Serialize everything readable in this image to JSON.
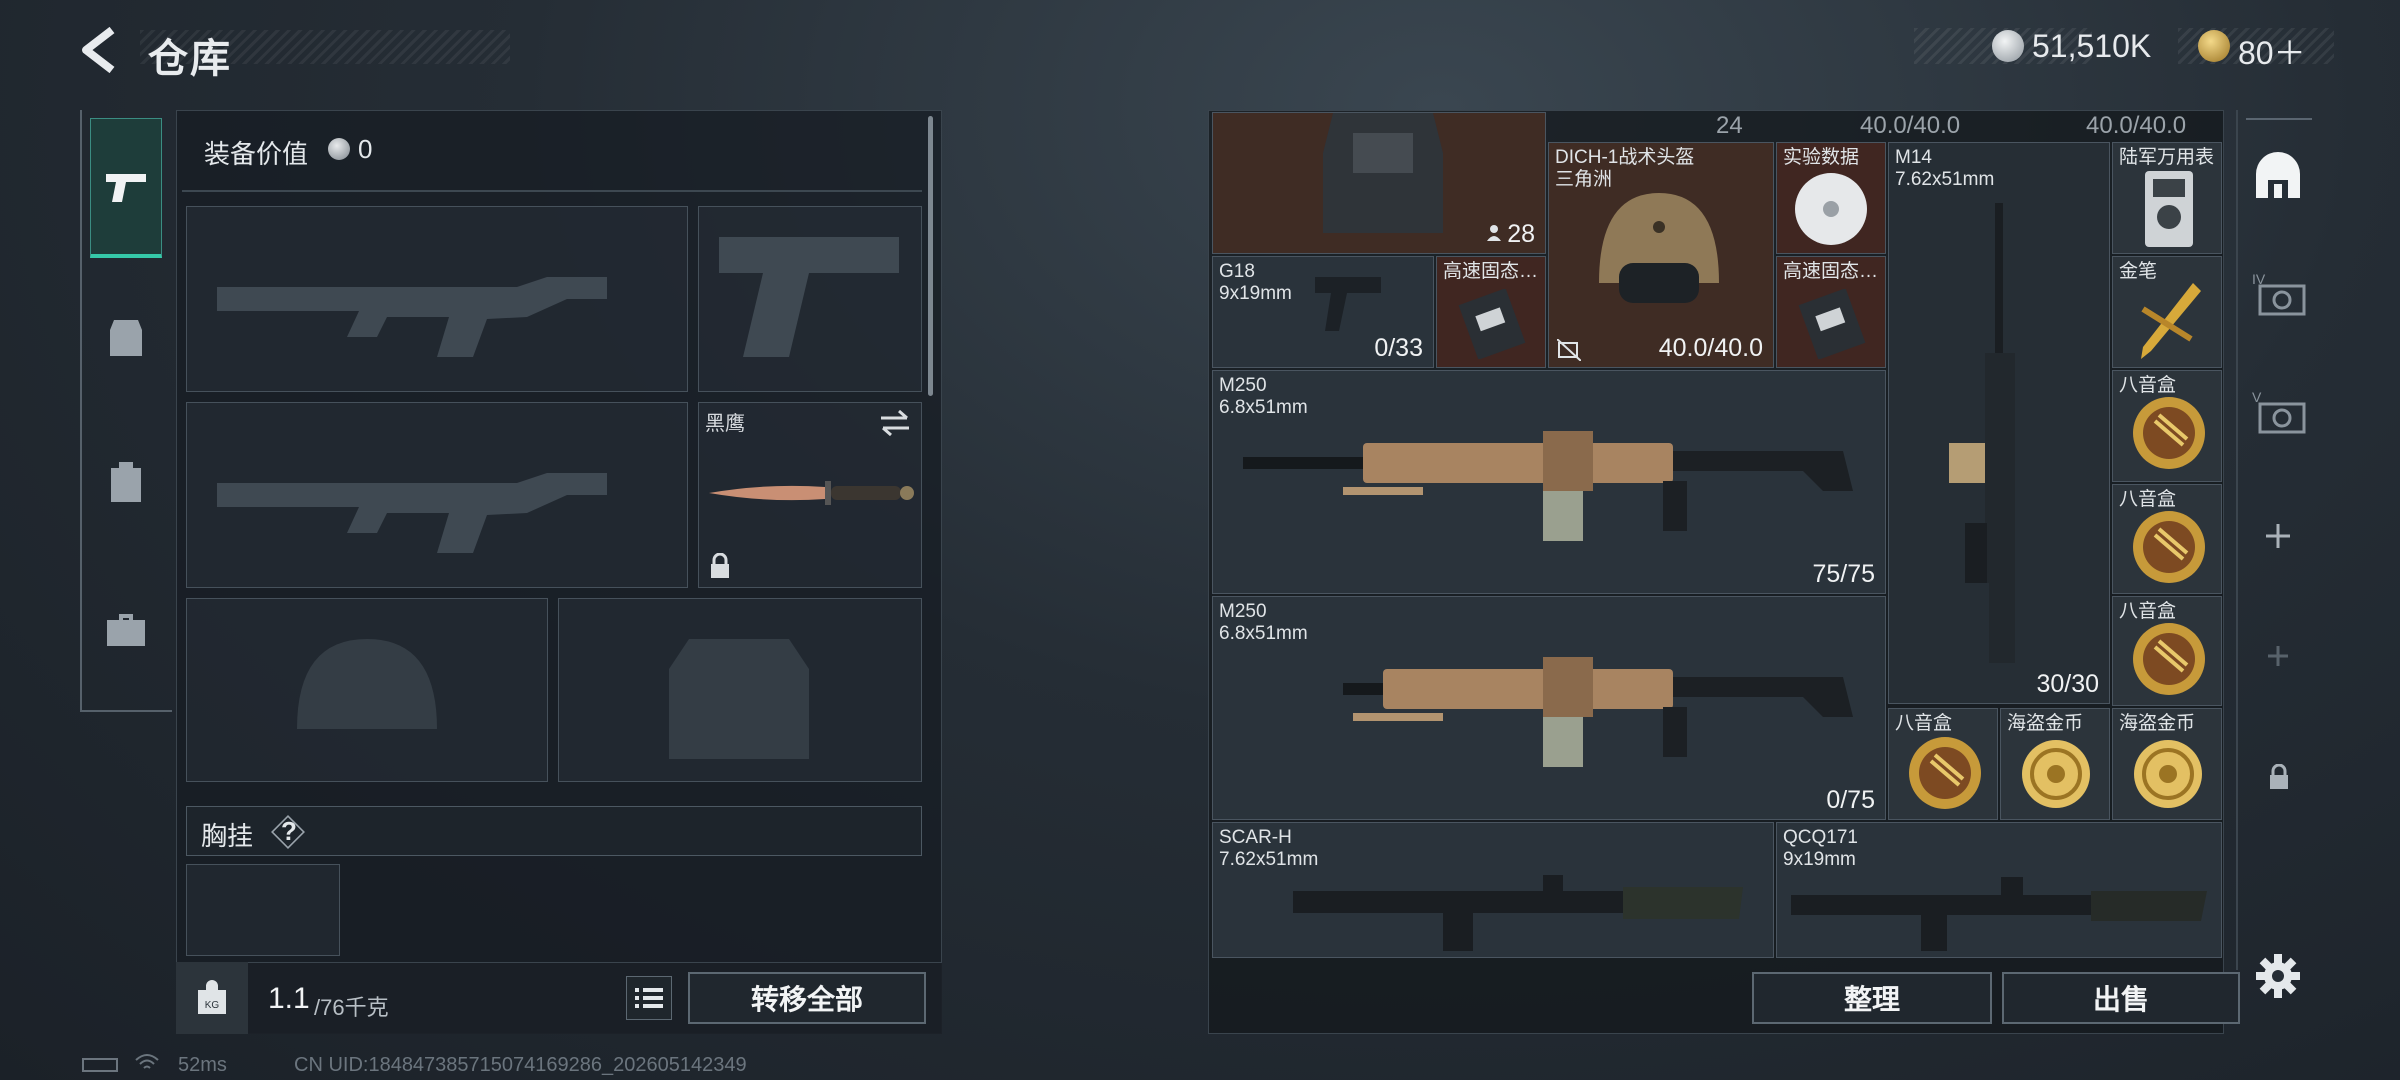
{
  "header": {
    "title": "仓库",
    "currency1": "51,510K",
    "currency2": "80＋"
  },
  "left": {
    "equip_value_label": "装备价值",
    "equip_value": "0",
    "knife_name": "黑鹰",
    "chest_label": "胸挂",
    "chest_help": "?",
    "weight_current": "1.1",
    "weight_max": "/76千克",
    "transfer_all": "转移全部"
  },
  "grid": {
    "items": [
      {
        "name": "",
        "count": "28"
      },
      {
        "name": "DICH-1战术头盔\n三角洲",
        "count": "40.0/40.0"
      },
      {
        "name": "实验数据",
        "count": ""
      },
      {
        "name": "M14\n7.62x51mm",
        "count": "30/30"
      },
      {
        "name": "陆军万用表",
        "count": ""
      },
      {
        "name": "G18\n9x19mm",
        "count": "0/33"
      },
      {
        "name": "高速固态…",
        "count": ""
      },
      {
        "name": "高速固态…",
        "count": ""
      },
      {
        "name": "金笔",
        "count": ""
      },
      {
        "name": "M250\n6.8x51mm",
        "count": "75/75"
      },
      {
        "name": "八音盒",
        "count": ""
      },
      {
        "name": "八音盒",
        "count": ""
      },
      {
        "name": "M250\n6.8x51mm",
        "count": "0/75"
      },
      {
        "name": "八音盒",
        "count": ""
      },
      {
        "name": "八音盒",
        "count": ""
      },
      {
        "name": "海盗金币",
        "count": ""
      },
      {
        "name": "海盗金币",
        "count": ""
      },
      {
        "name": "SCAR-H\n7.62x51mm",
        "count": ""
      },
      {
        "name": "QCQ171\n9x19mm",
        "count": ""
      }
    ],
    "top_counts": [
      "24",
      "40.0/40.0",
      "40.0/40.0"
    ]
  },
  "bottom": {
    "sort": "整理",
    "sell": "出售"
  },
  "status": {
    "ping": "52ms",
    "uid": "CN UID:184847385715074169286_202605142349"
  },
  "colors": {
    "accent": "#35c9a8",
    "brown_cell": "#3f2c24",
    "gold": "#c9a24a"
  }
}
